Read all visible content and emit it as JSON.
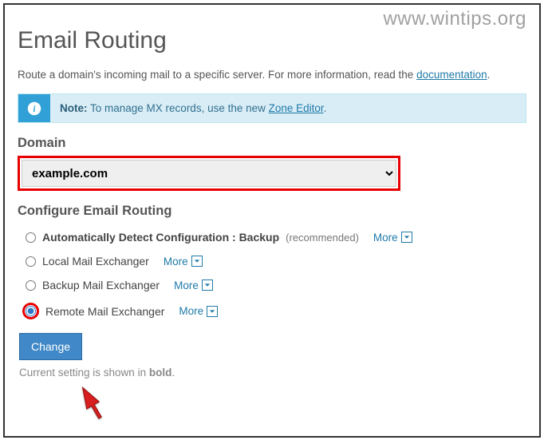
{
  "watermark": "www.wintips.org",
  "title": "Email Routing",
  "description_prefix": "Route a domain's incoming mail to a specific server. For more information, read the ",
  "description_link": "documentation",
  "description_suffix": ".",
  "alert": {
    "note_label": "Note:",
    "text_prefix": " To manage MX records, use the new ",
    "link": "Zone Editor",
    "text_suffix": "."
  },
  "domain_label": "Domain",
  "domain_value": "example.com",
  "configure_label": "Configure Email Routing",
  "options": [
    {
      "label": "Automatically Detect Configuration : Backup",
      "recommended": "(recommended)",
      "bold": true
    },
    {
      "label": "Local Mail Exchanger"
    },
    {
      "label": "Backup Mail Exchanger"
    },
    {
      "label": "Remote Mail Exchanger",
      "selected": true
    }
  ],
  "more_label": "More",
  "change_button": "Change",
  "hint_prefix": "Current setting is shown in ",
  "hint_bold": "bold",
  "hint_suffix": "."
}
